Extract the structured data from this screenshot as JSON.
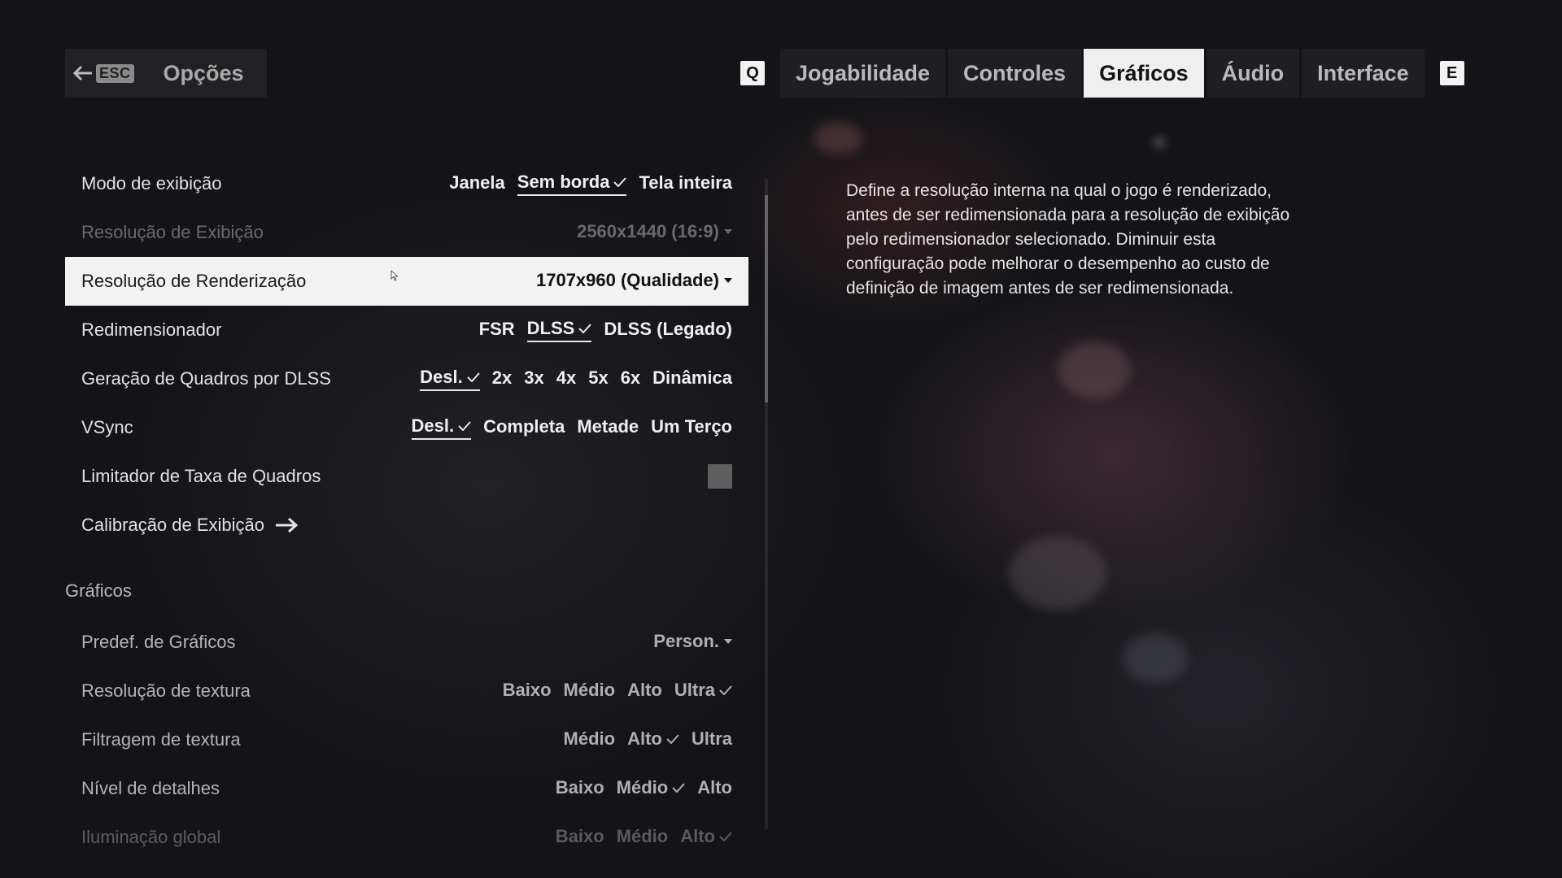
{
  "header": {
    "back_key": "ESC",
    "title": "Opções"
  },
  "tabs": {
    "prev_key": "Q",
    "next_key": "E",
    "items": [
      "Jogabilidade",
      "Controles",
      "Gráficos",
      "Áudio",
      "Interface"
    ],
    "active": "Gráficos"
  },
  "display": {
    "mode": {
      "label": "Modo de exibição",
      "options": [
        "Janela",
        "Sem borda",
        "Tela inteira"
      ],
      "selected": "Sem borda"
    },
    "resolution": {
      "label": "Resolução de Exibição",
      "value": "2560x1440 (16:9)"
    },
    "render_resolution": {
      "label": "Resolução de Renderização",
      "value": "1707x960 (Qualidade)"
    },
    "upscaler": {
      "label": "Redimensionador",
      "options": [
        "FSR",
        "DLSS",
        "DLSS (Legado)"
      ],
      "selected": "DLSS"
    },
    "frame_gen": {
      "label": "Geração de Quadros por DLSS",
      "options": [
        "Desl.",
        "2x",
        "3x",
        "4x",
        "5x",
        "6x",
        "Dinâmica"
      ],
      "selected": "Desl."
    },
    "vsync": {
      "label": "VSync",
      "options": [
        "Desl.",
        "Completa",
        "Metade",
        "Um Terço"
      ],
      "selected": "Desl."
    },
    "frame_limiter": {
      "label": "Limitador de Taxa de Quadros",
      "enabled": false
    },
    "calibration": {
      "label": "Calibração de Exibição"
    }
  },
  "graphics": {
    "section_title": "Gráficos",
    "preset": {
      "label": "Predef. de Gráficos",
      "value": "Person."
    },
    "texture_res": {
      "label": "Resolução de textura",
      "options": [
        "Baixo",
        "Médio",
        "Alto",
        "Ultra"
      ],
      "selected": "Ultra"
    },
    "texture_filter": {
      "label": "Filtragem de textura",
      "options": [
        "Médio",
        "Alto",
        "Ultra"
      ],
      "selected": "Alto"
    },
    "detail_level": {
      "label": "Nível de detalhes",
      "options": [
        "Baixo",
        "Médio",
        "Alto"
      ],
      "selected": "Médio"
    },
    "global_illum": {
      "label": "Iluminação global",
      "options": [
        "Baixo",
        "Médio",
        "Alto"
      ],
      "selected": "Alto"
    }
  },
  "description": "Define a resolução interna na qual o jogo é renderizado, antes de ser redimensionada para a resolução de exibição pelo redimensionador selecionado. Diminuir esta configuração pode melhorar o desempenho ao custo de definição de imagem antes de ser redimensionada.",
  "colors": {
    "accent": "#efefef",
    "background": "#141418",
    "disabled_text": "#6a6a6a"
  }
}
